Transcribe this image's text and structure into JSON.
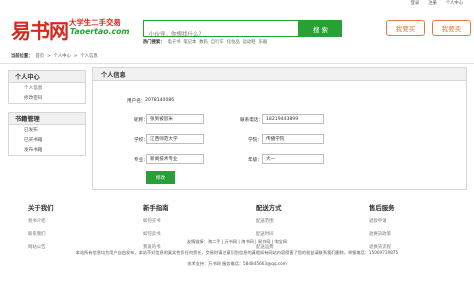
{
  "top_links": [
    "登录",
    "注册",
    "个人中心"
  ],
  "logo": {
    "text": "易书网",
    "slogan": "大学生二手交易",
    "url": "Taoertao.com"
  },
  "search": {
    "placeholder": "小伙伴，你想找什么？",
    "button": "搜 索"
  },
  "hot": {
    "label": "热门搜索：",
    "items": [
      "电子书",
      "笔记本",
      "数码",
      "自行车",
      "化妆品",
      "运动鞋",
      "乐器"
    ]
  },
  "actions": {
    "buy": "我要买",
    "sell": "我要卖"
  },
  "breadcrumb": {
    "lead": "当前位置：",
    "items": [
      "首页",
      ">",
      "个人中心",
      ">",
      "个人信息"
    ]
  },
  "sidebar": [
    {
      "title": "个人中心",
      "items": [
        "个人信息",
        "修改密码"
      ]
    },
    {
      "title": "书籍管理",
      "items": [
        "已发布",
        "已买书籍",
        "发布书籍"
      ]
    }
  ],
  "panel": {
    "title": "个人信息",
    "user_no_label": "用户名：",
    "user_no_value": "2078140086",
    "rows": [
      {
        "l1": "昵称：",
        "v1": "张到被思米",
        "l2": "联系电话：",
        "v2": "18219443899"
      },
      {
        "l1": "学校：",
        "v1": "江西师范大学",
        "l2": "学院：",
        "v2": "传播学院"
      },
      {
        "l1": "专业：",
        "v1": "新闻技术专业",
        "l2": "年级：",
        "v2": "大一"
      }
    ],
    "submit": "修改"
  },
  "footer": {
    "cols": [
      {
        "title": "关于我们",
        "links": [
          "易书介绍",
          "联系我们",
          "网站公告"
        ]
      },
      {
        "title": "新手指南",
        "links": [
          "如何买书",
          "如何卖书",
          "我发的书"
        ]
      },
      {
        "title": "配送方式",
        "links": [
          "配送范围",
          "配送时间",
          "配送运费"
        ]
      },
      {
        "title": "售后服务",
        "links": [
          "退款申请",
          "退换货政策",
          "退换货流程"
        ]
      }
    ],
    "copyright": [
      "友情链接：淘二手 | 万书网 | 淘书网 | 易书网 | 淘宝网",
      "本站所有信息均为用户自由发布，本站不对信息的真实性负任何责任，交易时请注意识别信息的真假如有网站内容侵害了您的权益请联系我们删除，举报电话：15069719875",
      "技术支持：万书网  服务电话：584845663@qq.com"
    ]
  }
}
